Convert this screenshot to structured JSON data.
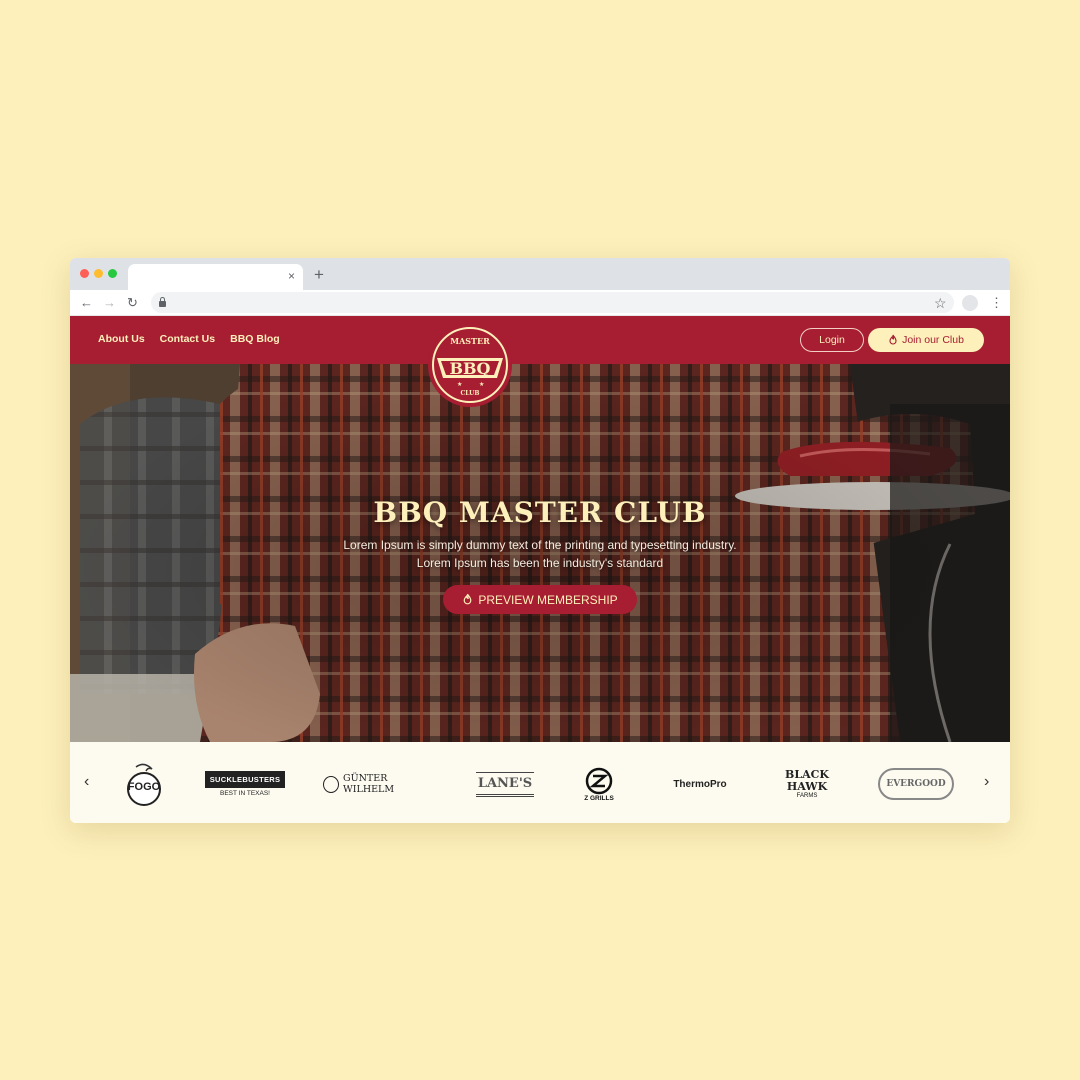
{
  "browser": {
    "close_glyph": "×",
    "newtab_glyph": "+",
    "back_glyph": "←",
    "forward_glyph": "→",
    "reload_glyph": "↻",
    "star_glyph": "☆",
    "menu_glyph": "⋮"
  },
  "nav": {
    "links": [
      "About Us",
      "Contact Us",
      "BBQ Blog"
    ],
    "login_label": "Login",
    "join_label": "Join our Club"
  },
  "logo": {
    "top_text": "MASTER",
    "main_text": "BBQ",
    "bottom_text": "CLUB"
  },
  "hero": {
    "title": "BBQ MASTER CLUB",
    "description": "Lorem Ipsum is simply dummy text of the printing and typesetting industry. Lorem Ipsum has been the industry's standard",
    "cta_label": "PREVIEW MEMBERSHIP"
  },
  "brands": {
    "prev_glyph": "‹",
    "next_glyph": "›",
    "items": [
      {
        "text": "FOGO"
      },
      {
        "text": "SUCKLEBUSTERS",
        "sub": "BEST IN TEXAS!"
      },
      {
        "text": "GÜNTER WILHELM"
      },
      {
        "text": "LANE'S"
      },
      {
        "text": "Z GRILLS"
      },
      {
        "text": "ThermoPro"
      },
      {
        "text": "BLACK HAWK",
        "sub": "FARMS"
      },
      {
        "text": "EVERGOOD"
      }
    ]
  },
  "colors": {
    "background": "#fdf0bb",
    "brand_red": "#a71d31",
    "cream": "#fdf0bb"
  }
}
